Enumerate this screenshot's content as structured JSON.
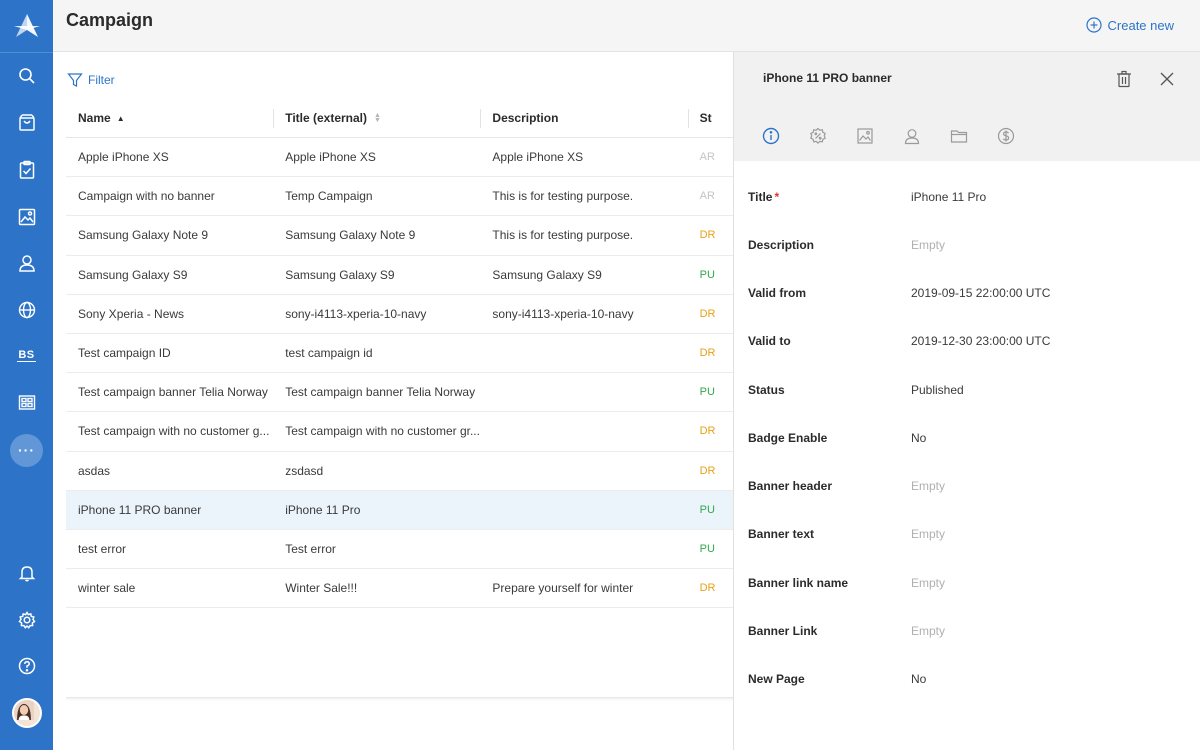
{
  "app": {
    "page_title": "Campaign",
    "create_new_label": "Create new",
    "filter_label": "Filter"
  },
  "sidebar": {
    "items": [
      {
        "icon": "search-icon"
      },
      {
        "icon": "shopping-bag-icon"
      },
      {
        "icon": "clipboard-check-icon"
      },
      {
        "icon": "image-icon"
      },
      {
        "icon": "user-icon"
      },
      {
        "icon": "globe-icon"
      },
      {
        "label": "BS"
      },
      {
        "icon": "grid-window-icon"
      },
      {
        "icon": "more-icon"
      }
    ],
    "bottom": [
      {
        "icon": "bell-icon"
      },
      {
        "icon": "gear-icon"
      },
      {
        "icon": "help-icon"
      },
      {
        "icon": "avatar"
      }
    ]
  },
  "table": {
    "columns": [
      "Name",
      "Title (external)",
      "Description",
      "St"
    ],
    "rows": [
      {
        "name": "Apple iPhone XS",
        "title": "Apple iPhone XS",
        "description": "Apple iPhone XS",
        "status": "AR",
        "status_kind": "arch"
      },
      {
        "name": "Campaign with no banner",
        "title": "Temp Campaign",
        "description": "This is for testing purpose.",
        "status": "AR",
        "status_kind": "arch"
      },
      {
        "name": "Samsung Galaxy Note 9",
        "title": "Samsung Galaxy Note 9",
        "description": "This is for testing purpose.",
        "status": "DR",
        "status_kind": "draft"
      },
      {
        "name": "Samsung Galaxy S9",
        "title": "Samsung Galaxy S9",
        "description": "Samsung Galaxy S9",
        "status": "PU",
        "status_kind": "pub"
      },
      {
        "name": "Sony Xperia - News",
        "title": "sony-i4113-xperia-10-navy",
        "description": "sony-i4113-xperia-10-navy",
        "status": "DR",
        "status_kind": "draft"
      },
      {
        "name": "Test campaign ID",
        "title": "test campaign id",
        "description": "",
        "status": "DR",
        "status_kind": "draft"
      },
      {
        "name": "Test campaign banner Telia Norway",
        "title": "Test campaign banner Telia Norway",
        "description": "",
        "status": "PU",
        "status_kind": "pub"
      },
      {
        "name": "Test campaign with no customer g...",
        "title": "Test campaign with no customer gr...",
        "description": "",
        "status": "DR",
        "status_kind": "draft"
      },
      {
        "name": "asdas",
        "title": "zsdasd",
        "description": "",
        "status": "DR",
        "status_kind": "draft"
      },
      {
        "name": "iPhone 11 PRO banner",
        "title": "iPhone 11 Pro",
        "description": "",
        "status": "PU",
        "status_kind": "pub",
        "selected": true
      },
      {
        "name": "test error",
        "title": "Test error",
        "description": "",
        "status": "PU",
        "status_kind": "pub"
      },
      {
        "name": "winter sale",
        "title": "Winter Sale!!!",
        "description": "Prepare yourself for winter",
        "status": "DR",
        "status_kind": "draft"
      }
    ]
  },
  "panel": {
    "title": "iPhone 11 PRO banner",
    "tabs": [
      "info-icon",
      "discount-icon",
      "image-icon",
      "user-icon",
      "folder-icon",
      "dollar-icon"
    ],
    "fields": [
      {
        "label": "Title",
        "value": "iPhone 11 Pro",
        "required": true
      },
      {
        "label": "Description",
        "value": "Empty",
        "empty": true
      },
      {
        "label": "Valid from",
        "value": "2019-09-15 22:00:00 UTC"
      },
      {
        "label": "Valid to",
        "value": "2019-12-30 23:00:00 UTC"
      },
      {
        "label": "Status",
        "value": "Published"
      },
      {
        "label": "Badge Enable",
        "value": "No"
      },
      {
        "label": "Banner header",
        "value": "Empty",
        "empty": true
      },
      {
        "label": "Banner text",
        "value": "Empty",
        "empty": true
      },
      {
        "label": "Banner link name",
        "value": "Empty",
        "empty": true
      },
      {
        "label": "Banner Link",
        "value": "Empty",
        "empty": true
      },
      {
        "label": "New Page",
        "value": "No"
      }
    ]
  },
  "colors": {
    "brand": "#2d74c9",
    "draft": "#e8a015",
    "published": "#2fa84f",
    "archived": "#c4c4c4",
    "required": "#e0362c"
  }
}
